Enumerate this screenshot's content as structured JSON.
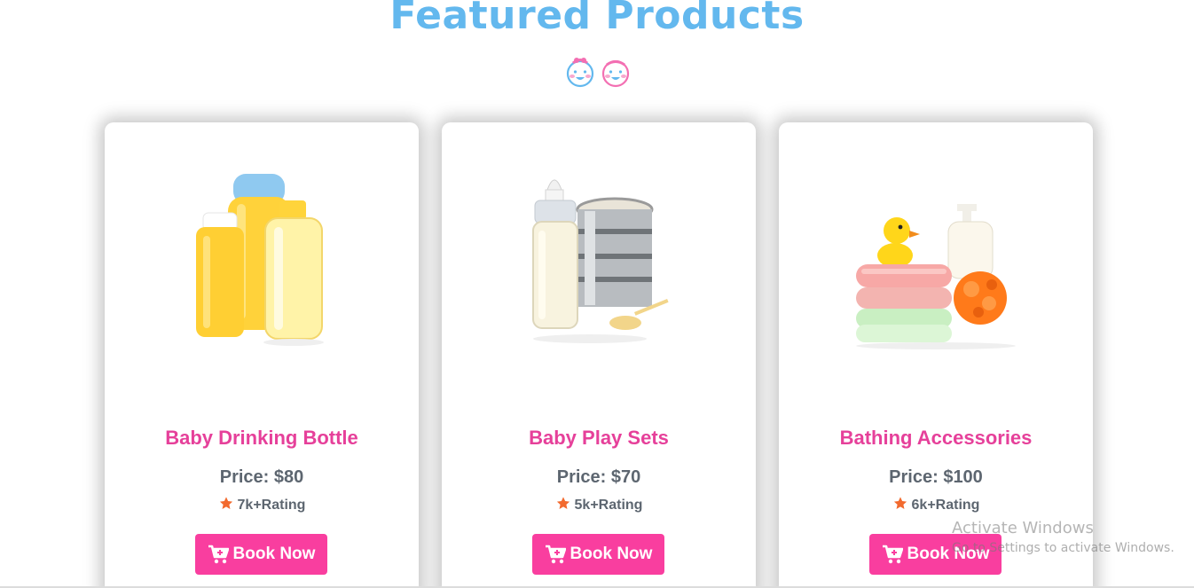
{
  "section": {
    "title": "Featured Products"
  },
  "products": [
    {
      "name": "Baby Drinking Bottle",
      "price": "Price: $80",
      "rating": "7k+Rating",
      "button_label": "Book Now",
      "image": "baby-oil-bottles"
    },
    {
      "name": "Baby Play Sets",
      "price": "Price: $70",
      "rating": "5k+Rating",
      "button_label": "Book Now",
      "image": "milk-bottle-and-formula-tin"
    },
    {
      "name": "Bathing Accessories",
      "price": "Price: $100",
      "rating": "6k+Rating",
      "button_label": "Book Now",
      "image": "towels-duck-and-sponge"
    }
  ],
  "watermark": {
    "title": "Activate Windows",
    "subtitle": "Go to Settings to activate Windows."
  },
  "colors": {
    "title": "#63b8ee",
    "product_name": "#e6409a",
    "button": "#f93e9f",
    "star": "#f26a2e",
    "text_muted": "#5d6670"
  },
  "icons": {
    "star": "star-icon",
    "cart": "cart-icon"
  }
}
